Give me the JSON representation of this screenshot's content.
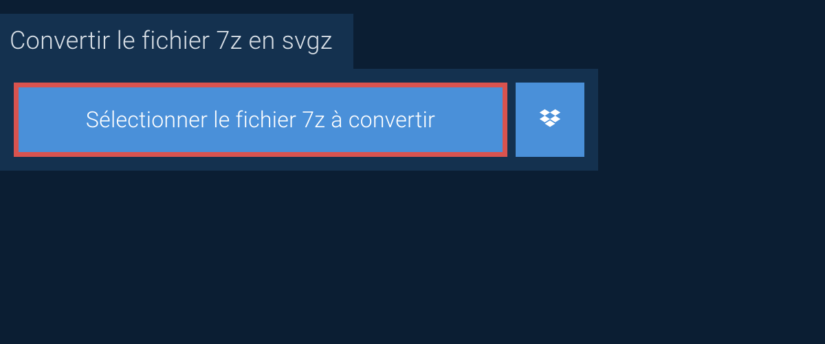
{
  "header": {
    "title": "Convertir le fichier 7z en svgz"
  },
  "upload": {
    "select_label": "Sélectionner le fichier 7z à convertir"
  },
  "colors": {
    "bg_dark": "#0b1e33",
    "panel": "#14314f",
    "button": "#4a90d9",
    "highlight_border": "#d9534f",
    "text_light": "#d8dfe6"
  }
}
